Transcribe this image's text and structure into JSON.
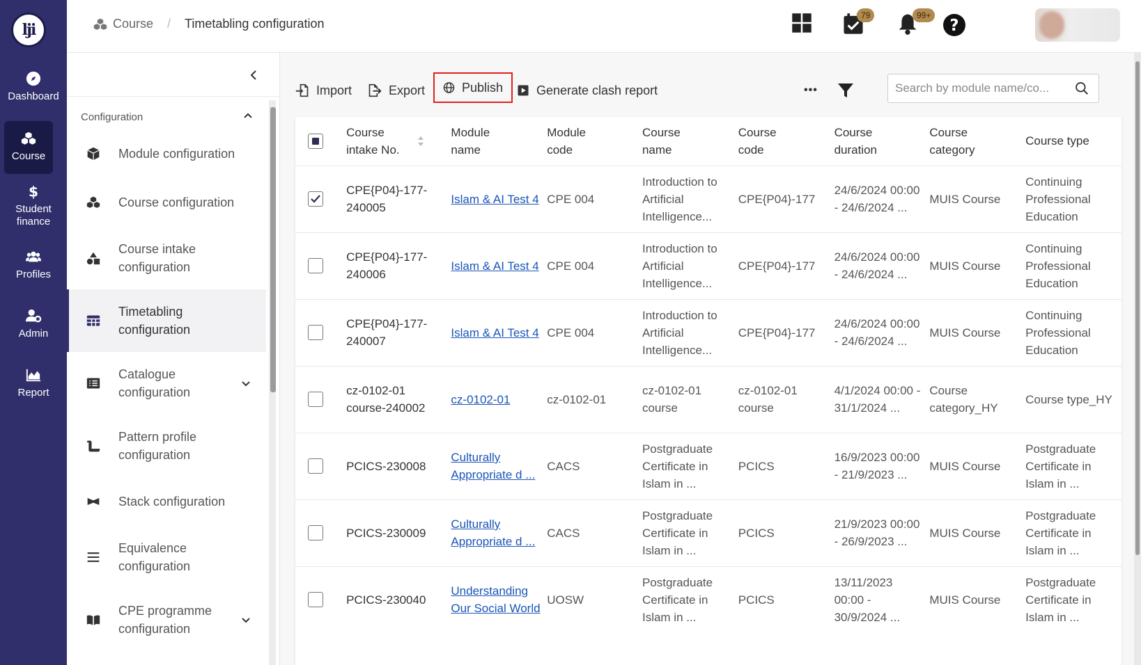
{
  "nav": {
    "items": [
      {
        "label": "Dashboard",
        "icon": "compass-icon"
      },
      {
        "label": "Course",
        "icon": "cubes-icon",
        "active": true
      },
      {
        "label": "Student finance",
        "icon": "dollar-icon"
      },
      {
        "label": "Profiles",
        "icon": "users-icon"
      },
      {
        "label": "Admin",
        "icon": "user-gear-icon"
      },
      {
        "label": "Report",
        "icon": "area-chart-icon"
      }
    ]
  },
  "header": {
    "breadcrumb_root": "Course",
    "breadcrumb_separator": "/",
    "breadcrumb_current": "Timetabling configuration",
    "tasks_badge": "79",
    "notifications_badge": "99+",
    "help_icon": "?"
  },
  "sidebar": {
    "section_title": "Configuration",
    "items": [
      {
        "label": "Module configuration",
        "icon": "cube-icon"
      },
      {
        "label": "Course configuration",
        "icon": "cubes-icon"
      },
      {
        "label": "Course intake configuration",
        "icon": "shapes-icon"
      },
      {
        "label": "Timetabling configuration",
        "icon": "table-icon",
        "active": true
      },
      {
        "label": "Catalogue configuration",
        "icon": "list-icon",
        "expandable": true
      },
      {
        "label": "Pattern profile configuration",
        "icon": "scroll-icon"
      },
      {
        "label": "Stack configuration",
        "icon": "stack-icon"
      },
      {
        "label": "Equivalence configuration",
        "icon": "bars-icon"
      },
      {
        "label": "CPE programme configuration",
        "icon": "book-icon",
        "expandable": true
      }
    ]
  },
  "toolbar": {
    "import_label": "Import",
    "export_label": "Export",
    "publish_label": "Publish",
    "clash_label": "Generate clash report",
    "more_label": "•••",
    "search_placeholder": "Search by module name/co..."
  },
  "table": {
    "headers": [
      "Course intake No.",
      "Module name",
      "Module code",
      "Course name",
      "Course code",
      "Course duration",
      "Course category",
      "Course type"
    ],
    "rows": [
      {
        "checked": true,
        "intake": "CPE{P04}-177-240005",
        "module": "Islam & AI Test 4",
        "code": "CPE 004",
        "course_name": "Introduction to Artificial Intelligence...",
        "course_code": "CPE{P04}-177",
        "duration": "24/6/2024 00:00 - 24/6/2024 ...",
        "category": "MUIS Course",
        "type": "Continuing Professional Education"
      },
      {
        "checked": false,
        "intake": "CPE{P04}-177-240006",
        "module": "Islam & AI Test 4",
        "code": "CPE 004",
        "course_name": "Introduction to Artificial Intelligence...",
        "course_code": "CPE{P04}-177",
        "duration": "24/6/2024 00:00 - 24/6/2024 ...",
        "category": "MUIS Course",
        "type": "Continuing Professional Education"
      },
      {
        "checked": false,
        "intake": "CPE{P04}-177-240007",
        "module": "Islam & AI Test 4",
        "code": "CPE 004",
        "course_name": "Introduction to Artificial Intelligence...",
        "course_code": "CPE{P04}-177",
        "duration": "24/6/2024 00:00 - 24/6/2024 ...",
        "category": "MUIS Course",
        "type": "Continuing Professional Education"
      },
      {
        "checked": false,
        "intake": "cz-0102-01 course-240002",
        "module": "cz-0102-01",
        "code": "cz-0102-01",
        "course_name": "cz-0102-01 course",
        "course_code": "cz-0102-01 course",
        "duration": "4/1/2024 00:00 - 31/1/2024 ...",
        "category": "Course category_HY",
        "type": "Course type_HY"
      },
      {
        "checked": false,
        "intake": "PCICS-230008",
        "module": "Culturally Appropriate d ...",
        "code": "CACS",
        "course_name": "Postgraduate Certificate in Islam in ...",
        "course_code": "PCICS",
        "duration": "16/9/2023 00:00 - 21/9/2023 ...",
        "category": "MUIS Course",
        "type": "Postgraduate Certificate in Islam in ..."
      },
      {
        "checked": false,
        "intake": "PCICS-230009",
        "module": "Culturally Appropriate d ...",
        "code": "CACS",
        "course_name": "Postgraduate Certificate in Islam in ...",
        "course_code": "PCICS",
        "duration": "21/9/2023 00:00 - 26/9/2023 ...",
        "category": "MUIS Course",
        "type": "Postgraduate Certificate in Islam in ..."
      },
      {
        "checked": false,
        "intake": "PCICS-230040",
        "module": "Understanding Our Social World",
        "code": "UOSW",
        "course_name": "Postgraduate Certificate in Islam in ...",
        "course_code": "PCICS",
        "duration": "13/11/2023 00:00 - 30/9/2024 ...",
        "category": "MUIS Course",
        "type": "Postgraduate Certificate in Islam in ..."
      }
    ]
  },
  "colors": {
    "nav_bg": "#302f6b",
    "nav_active": "#1a1a47",
    "link": "#1a55b8",
    "highlight": "#e02020",
    "badge": "#b28a4f"
  }
}
